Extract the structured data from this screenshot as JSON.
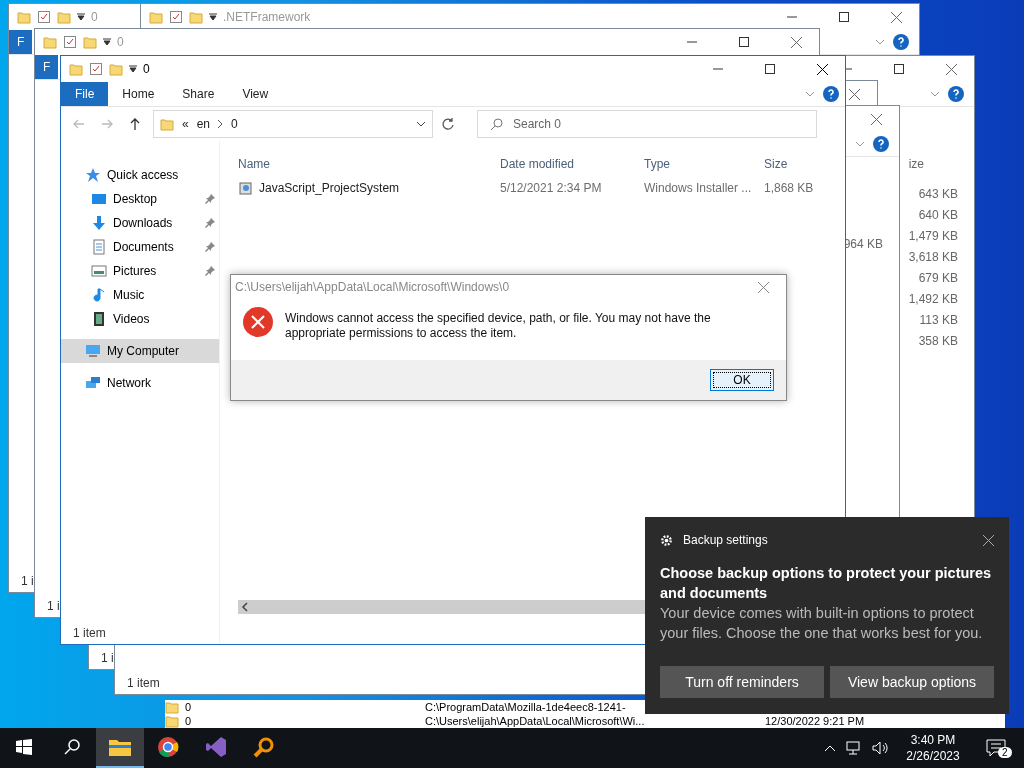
{
  "background_windows": [
    {
      "title": "0",
      "ribbon_tab": "F",
      "status": "1 i"
    },
    {
      "title": ".NETFramework"
    },
    {
      "title": "0",
      "ribbon_tab": "F",
      "status": "1 i"
    },
    {
      "size_header": "ize",
      "sizes": [
        "643 KB",
        "640 KB",
        "1,479 KB",
        "3,618 KB",
        "679 KB",
        "1,492 KB",
        "113 KB",
        "358 KB"
      ]
    },
    {
      "status": "1 i"
    },
    {
      "status": "1 item",
      "sizes": [
        "964 KB"
      ]
    }
  ],
  "explorer": {
    "title": "0",
    "ribbon_tabs": [
      {
        "label": "File",
        "selected": true
      },
      {
        "label": "Home",
        "selected": false
      },
      {
        "label": "Share",
        "selected": false
      },
      {
        "label": "View",
        "selected": false
      }
    ],
    "address": {
      "prefix": "«",
      "crumbs": [
        "en",
        "0"
      ]
    },
    "search": {
      "placeholder": "Search 0"
    },
    "nav": [
      {
        "label": "Quick access",
        "kind": "star",
        "selected": false,
        "pinned": false
      },
      {
        "label": "Desktop",
        "kind": "desktop",
        "selected": false,
        "pinned": true
      },
      {
        "label": "Downloads",
        "kind": "download",
        "selected": false,
        "pinned": true
      },
      {
        "label": "Documents",
        "kind": "document",
        "selected": false,
        "pinned": true
      },
      {
        "label": "Pictures",
        "kind": "picture",
        "selected": false,
        "pinned": true
      },
      {
        "label": "Music",
        "kind": "music",
        "selected": false,
        "pinned": false
      },
      {
        "label": "Videos",
        "kind": "video",
        "selected": false,
        "pinned": false
      },
      {
        "label": "My Computer",
        "kind": "computer",
        "selected": true,
        "pinned": false
      },
      {
        "label": "Network",
        "kind": "network",
        "selected": false,
        "pinned": false
      }
    ],
    "columns": [
      "Name",
      "Date modified",
      "Type",
      "Size"
    ],
    "rows": [
      {
        "name": "JavaScript_ProjectSystem",
        "date": "5/12/2021 2:34 PM",
        "type": "Windows Installer ...",
        "size": "1,868 KB"
      }
    ],
    "status": "1 item"
  },
  "dialog": {
    "title": "C:\\Users\\elijah\\AppData\\Local\\Microsoft\\Windows\\0",
    "message": "Windows cannot access the specified device, path, or file. You may not have the appropriate permissions to access the item.",
    "button": "OK"
  },
  "lower_window": {
    "rows": [
      {
        "name": "0",
        "path": "C:\\ProgramData\\Mozilla-1de4eec8-1241-"
      },
      {
        "name": "0",
        "path": "C:\\Users\\elijah\\AppData\\Local\\Microsoft\\Wi...",
        "date": "12/30/2022 9:21 PM"
      }
    ]
  },
  "toast": {
    "app": "Backup settings",
    "heading": "Choose backup options to protect your pictures and documents",
    "body": "Your device comes with built-in options to protect your files. Choose the one that works best for you.",
    "buttons": [
      "Turn off reminders",
      "View backup options"
    ]
  },
  "taskbar": {
    "apps": [
      {
        "kind": "explorer",
        "selected": true
      },
      {
        "kind": "chrome",
        "selected": false
      },
      {
        "kind": "studio",
        "selected": false
      },
      {
        "kind": "magnifier",
        "selected": false
      }
    ],
    "time": "3:40 PM",
    "date": "2/26/2023",
    "notifications": "2"
  }
}
